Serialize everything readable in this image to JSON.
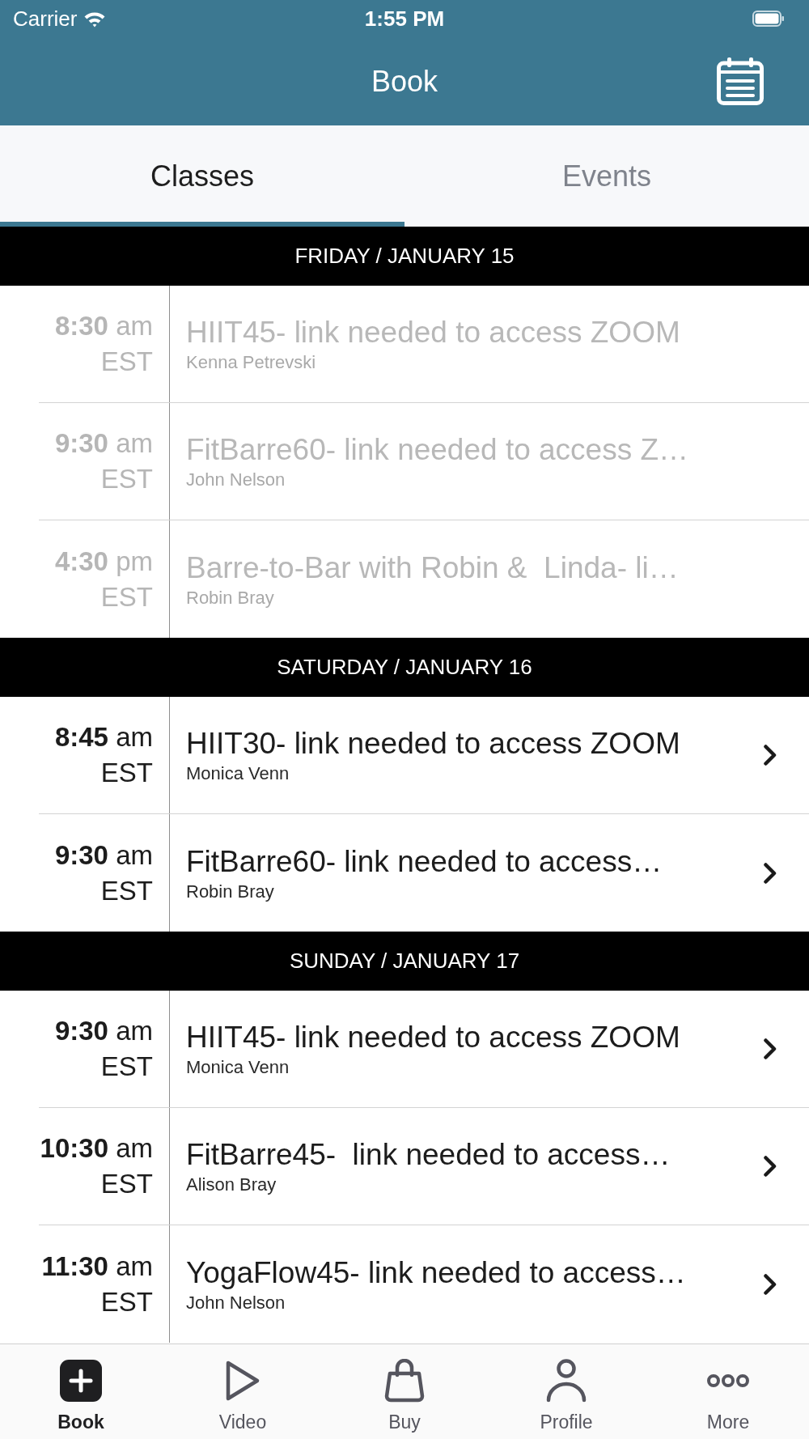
{
  "status_bar": {
    "carrier": "Carrier",
    "time": "1:55 PM"
  },
  "nav_bar": {
    "title": "Book"
  },
  "tabs": [
    {
      "label": "Classes",
      "selected": true
    },
    {
      "label": "Events",
      "selected": false
    }
  ],
  "schedule": [
    {
      "day": "FRIDAY / JANUARY 15",
      "classes": [
        {
          "time": "8:30",
          "meridiem": "am",
          "zone": "EST",
          "title": "HIIT45- link needed to access ZOOM",
          "instructor": "Kenna Petrevski",
          "disabled": true
        },
        {
          "time": "9:30",
          "meridiem": "am",
          "zone": "EST",
          "title": "FitBarre60- link needed to access Z…",
          "instructor": "John Nelson",
          "disabled": true
        },
        {
          "time": "4:30",
          "meridiem": "pm",
          "zone": "EST",
          "title": "Barre-to-Bar with Robin &  Linda- li…",
          "instructor": "Robin Bray",
          "disabled": true
        }
      ]
    },
    {
      "day": "SATURDAY / JANUARY 16",
      "classes": [
        {
          "time": "8:45",
          "meridiem": "am",
          "zone": "EST",
          "title": "HIIT30- link needed to access ZOOM",
          "instructor": "Monica Venn",
          "disabled": false
        },
        {
          "time": "9:30",
          "meridiem": "am",
          "zone": "EST",
          "title": "FitBarre60- link needed to access…",
          "instructor": "Robin Bray",
          "disabled": false
        }
      ]
    },
    {
      "day": "SUNDAY / JANUARY 17",
      "classes": [
        {
          "time": "9:30",
          "meridiem": "am",
          "zone": "EST",
          "title": "HIIT45- link needed to access ZOOM",
          "instructor": "Monica Venn",
          "disabled": false
        },
        {
          "time": "10:30",
          "meridiem": "am",
          "zone": "EST",
          "title": "FitBarre45-  link needed to access…",
          "instructor": "Alison Bray",
          "disabled": false
        },
        {
          "time": "11:30",
          "meridiem": "am",
          "zone": "EST",
          "title": "YogaFlow45- link needed to access…",
          "instructor": "John Nelson",
          "disabled": false
        }
      ]
    }
  ],
  "tab_bar": [
    {
      "label": "Book",
      "selected": true
    },
    {
      "label": "Video",
      "selected": false
    },
    {
      "label": "Buy",
      "selected": false
    },
    {
      "label": "Profile",
      "selected": false
    },
    {
      "label": "More",
      "selected": false
    }
  ]
}
